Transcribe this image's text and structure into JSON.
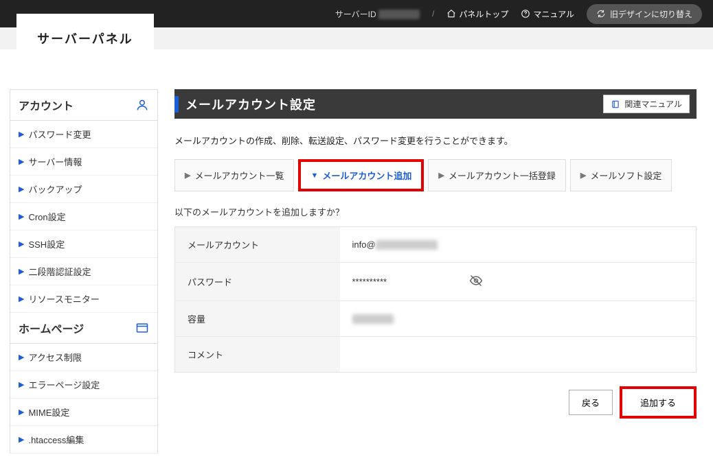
{
  "header": {
    "server_id_label": "サーバーID",
    "panel_top_label": "パネルトップ",
    "manual_label": "マニュアル",
    "switch_label": "旧デザインに切り替え",
    "logo_text": "サーバーパネル"
  },
  "sidebar": {
    "sections": [
      {
        "title": "アカウント",
        "icon": "user",
        "items": [
          {
            "label": "パスワード変更"
          },
          {
            "label": "サーバー情報"
          },
          {
            "label": "バックアップ"
          },
          {
            "label": "Cron設定"
          },
          {
            "label": "SSH設定"
          },
          {
            "label": "二段階認証設定"
          },
          {
            "label": "リソースモニター"
          }
        ]
      },
      {
        "title": "ホームページ",
        "icon": "window",
        "items": [
          {
            "label": "アクセス制限"
          },
          {
            "label": "エラーページ設定"
          },
          {
            "label": "MIME設定"
          },
          {
            "label": ".htaccess編集"
          }
        ]
      }
    ]
  },
  "main": {
    "title": "メールアカウント設定",
    "related_manual_label": "関連マニュアル",
    "description": "メールアカウントの作成、削除、転送設定、パスワード変更を行うことができます。",
    "tabs": [
      {
        "label": "メールアカウント一覧",
        "active": false
      },
      {
        "label": "メールアカウント追加",
        "active": true
      },
      {
        "label": "メールアカウント一括登録",
        "active": false
      },
      {
        "label": "メールソフト設定",
        "active": false
      }
    ],
    "confirm_text": "以下のメールアカウントを追加しますか？",
    "rows": {
      "mail_account_label": "メールアカウント",
      "mail_account_value": "info@",
      "password_label": "パスワード",
      "password_value": "**********",
      "capacity_label": "容量",
      "comment_label": "コメント"
    },
    "actions": {
      "back_label": "戻る",
      "submit_label": "追加する"
    }
  }
}
